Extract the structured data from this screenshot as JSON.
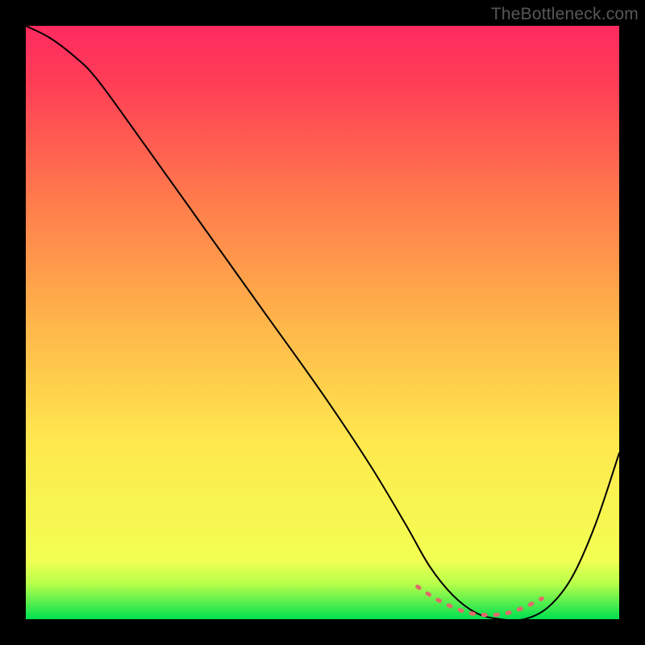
{
  "watermark": "TheBottleneck.com",
  "chart_data": {
    "type": "line",
    "title": "",
    "xlabel": "",
    "ylabel": "",
    "xlim": [
      0,
      100
    ],
    "ylim": [
      0,
      100
    ],
    "gradient_stops": [
      {
        "offset": 0,
        "color": "#00e050"
      },
      {
        "offset": 6,
        "color": "#b8ff4a"
      },
      {
        "offset": 10,
        "color": "#f2ff52"
      },
      {
        "offset": 30,
        "color": "#ffe84e"
      },
      {
        "offset": 50,
        "color": "#ffb54a"
      },
      {
        "offset": 70,
        "color": "#ff7d4c"
      },
      {
        "offset": 90,
        "color": "#ff3f56"
      },
      {
        "offset": 100,
        "color": "#ff2a60"
      }
    ],
    "series": [
      {
        "name": "bottleneck-curve",
        "color": "#000000",
        "stroke_width": 2,
        "x": [
          0,
          4,
          8,
          12,
          20,
          30,
          40,
          50,
          58,
          64,
          68,
          72,
          76,
          80,
          84,
          88,
          92,
          96,
          100
        ],
        "y": [
          100,
          98,
          95,
          91,
          80,
          66,
          52,
          38,
          26,
          16,
          9,
          4,
          1,
          0,
          0,
          2,
          7,
          16,
          28
        ]
      },
      {
        "name": "optimal-band",
        "color": "#e26a6a",
        "stroke_width": 5,
        "dashed": true,
        "x": [
          66,
          69,
          72,
          75,
          78,
          81,
          84,
          87
        ],
        "y": [
          5.5,
          3.5,
          2.0,
          1.0,
          0.7,
          1.0,
          2.0,
          3.5
        ]
      }
    ]
  }
}
